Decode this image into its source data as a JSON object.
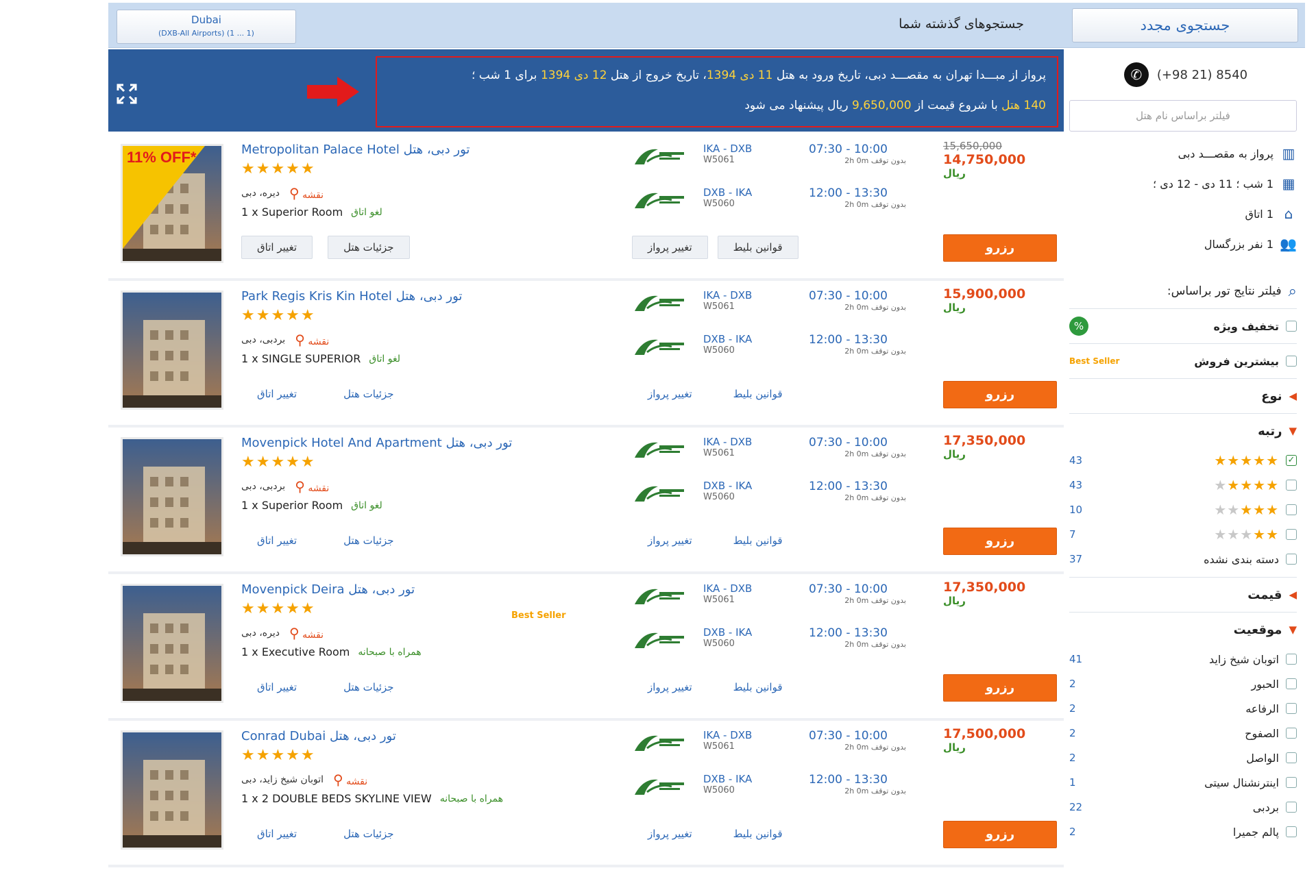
{
  "topbar": {
    "destination_label": "Dubai",
    "destination_sub": "(DXB-All Airports) (1 ... 1)",
    "previous_searches": "جستجوهای گذشته شما",
    "new_search": "جستجوی مجدد"
  },
  "banner": {
    "line1_a": "پرواز از مبـــدا تهران به مقصـــد دبی، تاریخ ورود به هتل ",
    "line1_date1": "11 دی 1394",
    "line1_b": "، تاریخ خروج از هتل ",
    "line1_date2": "12 دی 1394",
    "line1_c": " برای 1 شب ؛",
    "line2_count": "140 هتل",
    "line2_a": " با شروع قیمت از ",
    "line2_price": "9,650,000",
    "line2_b": " ریال پیشنهاد می شود"
  },
  "sidebar": {
    "phone": "(+98 21) 8540",
    "filter_placeholder": "فیلتر براساس نام هتل",
    "info": [
      {
        "icon": "building-icon",
        "text": "پرواز به مقصـــد دبی"
      },
      {
        "icon": "calendar-icon",
        "text": "1 شب ؛ 11 دی - 12 دی ؛"
      },
      {
        "icon": "home-icon",
        "text": "1 اتاق"
      },
      {
        "icon": "people-icon",
        "text": "1 نفر بزرگسال"
      }
    ],
    "filter_title": "فیلتر نتایج تور براساس:",
    "special_offer": "تخفیف ویژه",
    "best_seller": "بیشترین فروش",
    "best_seller_badge": "Best Seller",
    "type_title": "نوع",
    "rating_title": "رتبه",
    "ratings": [
      {
        "stars": 5,
        "count": "43",
        "checked": true
      },
      {
        "stars": 4,
        "count": "43",
        "checked": false
      },
      {
        "stars": 3,
        "count": "10",
        "checked": false
      },
      {
        "stars": 2,
        "count": "7",
        "checked": false
      }
    ],
    "unrated": {
      "label": "دسته بندی نشده",
      "count": "37"
    },
    "price_title": "قیمت",
    "location_title": "موقعیت",
    "locations": [
      {
        "label": "اتوبان شیخ زاید",
        "count": "41"
      },
      {
        "label": "الحبور",
        "count": "2"
      },
      {
        "label": "الرفاعه",
        "count": "2"
      },
      {
        "label": "الصفوح",
        "count": "2"
      },
      {
        "label": "الواصل",
        "count": "2"
      },
      {
        "label": "اینترنشنال سیتی",
        "count": "1"
      },
      {
        "label": "بردبی",
        "count": "22"
      },
      {
        "label": "پالم جمیرا",
        "count": "2"
      }
    ]
  },
  "common": {
    "map": "نقشه",
    "change_room": "تغییر اتاق",
    "hotel_details": "جزئیات هتل",
    "change_flight": "تغییر پرواز",
    "ticket_rules": "قوانین بلیط",
    "book": "رزرو",
    "currency": "ریال",
    "stop": "بدون توقف 2h 0m",
    "out_route": "IKA - DXB",
    "out_flight": "W5061",
    "out_time": "07:30 - 10:00",
    "ret_route": "DXB - IKA",
    "ret_flight": "W5060",
    "ret_time": "12:00 - 13:30",
    "off_label": "11% OFF*"
  },
  "hotels": [
    {
      "name": "Metropolitan Palace Hotel",
      "prefix": "تور دبی، هتل",
      "area": "دیره، دبی",
      "room": "1 x Superior Room",
      "note": "لغو اتاق",
      "old_price": "15,650,000",
      "price": "14,750,000",
      "best": false
    },
    {
      "name": "Park Regis Kris Kin Hotel",
      "prefix": "تور دبی، هتل",
      "area": "بردبی، دبی",
      "room": "1 x SINGLE SUPERIOR",
      "note": "لغو اتاق",
      "old_price": "",
      "price": "15,900,000",
      "best": false
    },
    {
      "name": "Movenpick Hotel And Apartment",
      "prefix": "تور دبی، هتل",
      "area": "بردبی، دبی",
      "room": "1 x Superior Room",
      "note": "لغو اتاق",
      "old_price": "",
      "price": "17,350,000",
      "best": false
    },
    {
      "name": "Movenpick Deira",
      "prefix": "تور دبی، هتل",
      "area": "دیره، دبی",
      "room": "1 x Executive Room",
      "note": "همراه با صبحانه",
      "old_price": "",
      "price": "17,350,000",
      "best": true
    },
    {
      "name": "Conrad Dubai",
      "prefix": "تور دبی، هتل",
      "area": "اتوبان شیخ زاید، دبی",
      "room": "1 x 2 DOUBLE BEDS SKYLINE VIEW",
      "note": "همراه با صبحانه",
      "old_price": "",
      "price": "17,500,000",
      "best": false
    }
  ]
}
